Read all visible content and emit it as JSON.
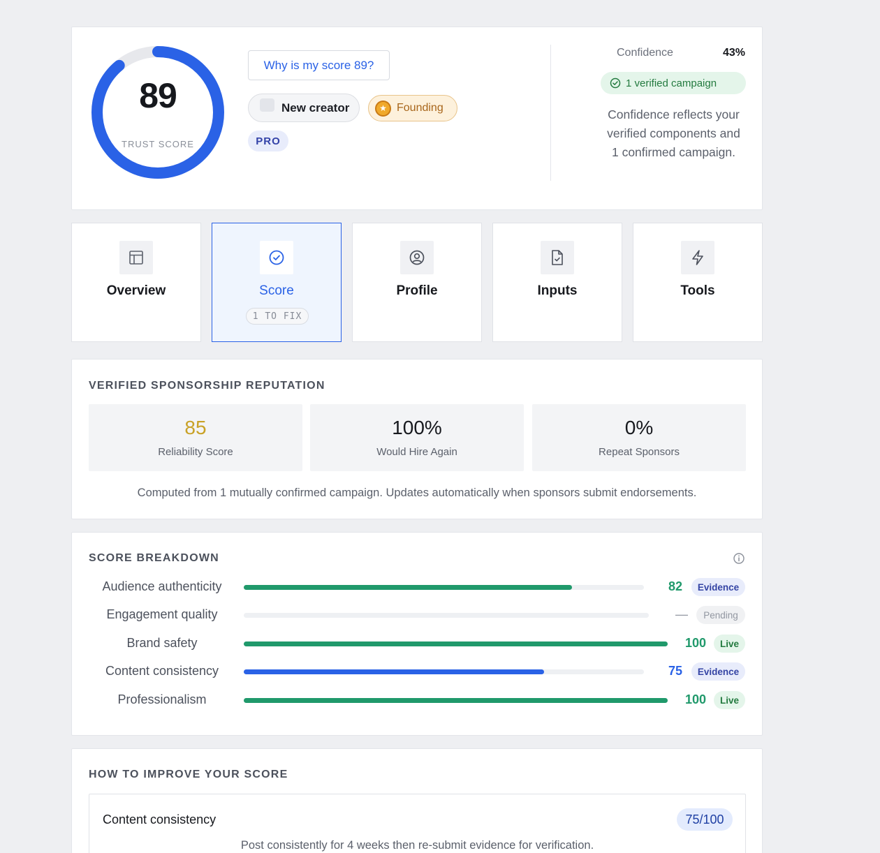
{
  "hero": {
    "score": "89",
    "score_fraction": 0.89,
    "score_label": "TRUST SCORE",
    "why_button": "Why is my score 89?",
    "chips": {
      "new_creator": "New creator",
      "founding": "Founding",
      "pro": "PRO"
    },
    "confidence_label": "Confidence",
    "confidence_value": "43%",
    "verified_pill": "1 verified campaign",
    "confidence_desc": "Confidence reflects your verified components and 1 confirmed campaign.",
    "colors": {
      "gauge": "#2a62e6",
      "gauge_track": "#e7e8ec"
    }
  },
  "nav": {
    "tiles": [
      {
        "label": "Overview",
        "icon": "layout-icon"
      },
      {
        "label": "Score",
        "icon": "check-circle-icon",
        "badge": "1 TO FIX",
        "active": true
      },
      {
        "label": "Profile",
        "icon": "user-circle-icon"
      },
      {
        "label": "Inputs",
        "icon": "file-check-icon"
      },
      {
        "label": "Tools",
        "icon": "lightning-icon"
      }
    ]
  },
  "reputation": {
    "title": "VERIFIED SPONSORSHIP REPUTATION",
    "stats": [
      {
        "value": "85",
        "label": "Reliability Score",
        "color": "#c9a227"
      },
      {
        "value": "100%",
        "label": "Would Hire Again",
        "color": "#17191e"
      },
      {
        "value": "0%",
        "label": "Repeat Sponsors",
        "color": "#17191e"
      }
    ],
    "note": "Computed from 1 mutually confirmed campaign. Updates automatically when sponsors submit endorsements."
  },
  "breakdown": {
    "title": "SCORE BREAKDOWN",
    "rows": [
      {
        "label": "Audience authenticity",
        "score": "82",
        "value": 82,
        "tag": "Evidence",
        "color": "#20996b"
      },
      {
        "label": "Engagement quality",
        "score": "—",
        "value": 0,
        "tag": "Pending",
        "color": "#9297a1"
      },
      {
        "label": "Brand safety",
        "score": "100",
        "value": 100,
        "tag": "Live",
        "color": "#20996b"
      },
      {
        "label": "Content consistency",
        "score": "75",
        "value": 75,
        "tag": "Evidence",
        "color": "#2a62e6"
      },
      {
        "label": "Professionalism",
        "score": "100",
        "value": 100,
        "tag": "Live",
        "color": "#20996b"
      }
    ]
  },
  "improve": {
    "title": "HOW TO IMPROVE YOUR SCORE",
    "items": [
      {
        "title": "Content consistency",
        "score": "75/100",
        "desc": "Post consistently for 4 weeks then re-submit evidence for verification."
      }
    ]
  }
}
